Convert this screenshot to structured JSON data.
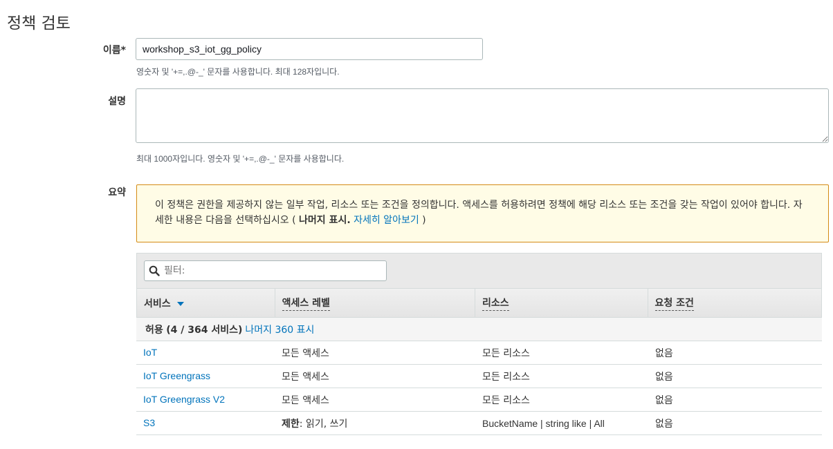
{
  "page": {
    "title": "정책 검토"
  },
  "name_field": {
    "label": "이름*",
    "value": "workshop_s3_iot_gg_policy",
    "hint": "영숫자 및 '+=,.@-_' 문자를 사용합니다. 최대 128자입니다."
  },
  "description_field": {
    "label": "설명",
    "value": "",
    "hint": "최대 1000자입니다. 영숫자 및 '+=,.@-_' 문자를 사용합니다."
  },
  "summary": {
    "label": "요약",
    "warning": {
      "text": "이 정책은 권한을 제공하지 않는 일부 작업, 리소스 또는 조건을 정의합니다. 액세스를 허용하려면 정책에 해당 리소스 또는 조건을 갖는 작업이 있어야 합니다. 자세한 내용은 다음을 선택하십시오 (",
      "show_more": "나머지 표시.",
      "learn_more": "자세히 알아보기",
      "close_paren": ")"
    }
  },
  "table": {
    "filter_placeholder": "필터:",
    "columns": [
      "서비스",
      "액세스 레벨",
      "리소스",
      "요청 조건"
    ],
    "group": {
      "prefix": "허용",
      "count": "(4 / 364 서비스)",
      "link": "나머지 360 표시"
    },
    "rows": [
      {
        "service": "IoT",
        "access_bold": "",
        "access": "모든 액세스",
        "resource": "모든 리소스",
        "condition": "없음"
      },
      {
        "service": "IoT Greengrass",
        "access_bold": "",
        "access": "모든 액세스",
        "resource": "모든 리소스",
        "condition": "없음"
      },
      {
        "service": "IoT Greengrass V2",
        "access_bold": "",
        "access": "모든 액세스",
        "resource": "모든 리소스",
        "condition": "없음"
      },
      {
        "service": "S3",
        "access_bold": "제한",
        "access": ": 읽기, 쓰기",
        "resource": "BucketName | string like | All",
        "condition": "없음"
      }
    ]
  },
  "colors": {
    "link": "#0073bb",
    "warning_border": "#d48a14",
    "warning_bg": "#fffce6"
  }
}
